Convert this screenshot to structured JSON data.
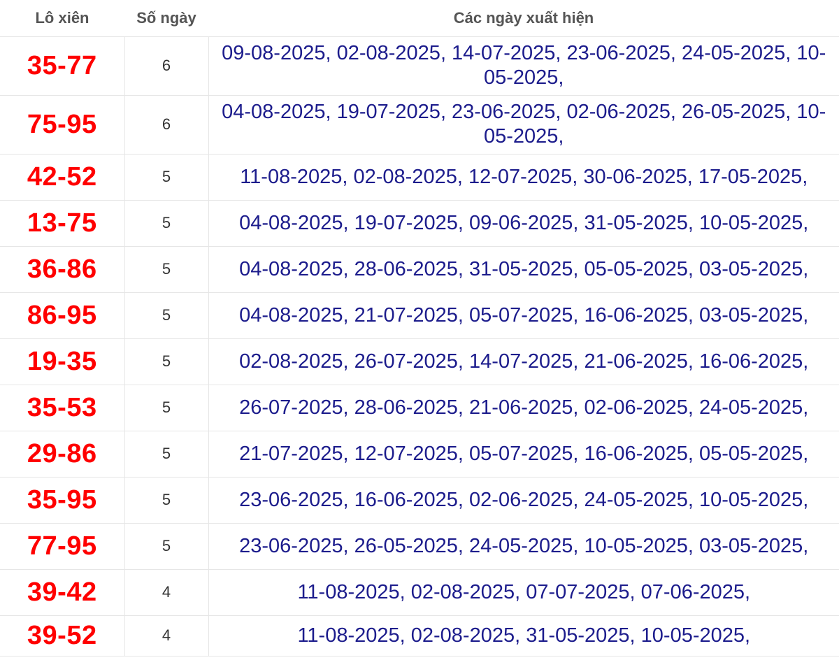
{
  "headers": {
    "pair": "Lô xiên",
    "days": "Số ngày",
    "dates": "Các ngày xuất hiện"
  },
  "colors": {
    "pair_text": "#ff0000",
    "dates_text": "#1c1c8c",
    "header_text": "#555555",
    "grid_line": "#e6e6e6"
  },
  "rows": [
    {
      "pair": "35-77",
      "days": "6",
      "dates": "09-08-2025, 02-08-2025, 14-07-2025, 23-06-2025, 24-05-2025, 10-05-2025,"
    },
    {
      "pair": "75-95",
      "days": "6",
      "dates": "04-08-2025, 19-07-2025, 23-06-2025, 02-06-2025, 26-05-2025, 10-05-2025,"
    },
    {
      "pair": "42-52",
      "days": "5",
      "dates": "11-08-2025, 02-08-2025, 12-07-2025, 30-06-2025, 17-05-2025,"
    },
    {
      "pair": "13-75",
      "days": "5",
      "dates": "04-08-2025, 19-07-2025, 09-06-2025, 31-05-2025, 10-05-2025,"
    },
    {
      "pair": "36-86",
      "days": "5",
      "dates": "04-08-2025, 28-06-2025, 31-05-2025, 05-05-2025, 03-05-2025,"
    },
    {
      "pair": "86-95",
      "days": "5",
      "dates": "04-08-2025, 21-07-2025, 05-07-2025, 16-06-2025, 03-05-2025,"
    },
    {
      "pair": "19-35",
      "days": "5",
      "dates": "02-08-2025, 26-07-2025, 14-07-2025, 21-06-2025, 16-06-2025,"
    },
    {
      "pair": "35-53",
      "days": "5",
      "dates": "26-07-2025, 28-06-2025, 21-06-2025, 02-06-2025, 24-05-2025,"
    },
    {
      "pair": "29-86",
      "days": "5",
      "dates": "21-07-2025, 12-07-2025, 05-07-2025, 16-06-2025, 05-05-2025,"
    },
    {
      "pair": "35-95",
      "days": "5",
      "dates": "23-06-2025, 16-06-2025, 02-06-2025, 24-05-2025, 10-05-2025,"
    },
    {
      "pair": "77-95",
      "days": "5",
      "dates": "23-06-2025, 26-05-2025, 24-05-2025, 10-05-2025, 03-05-2025,"
    },
    {
      "pair": "39-42",
      "days": "4",
      "dates": "11-08-2025, 02-08-2025, 07-07-2025, 07-06-2025,"
    },
    {
      "pair": "39-52",
      "days": "4",
      "dates": "11-08-2025, 02-08-2025, 31-05-2025, 10-05-2025,"
    }
  ]
}
